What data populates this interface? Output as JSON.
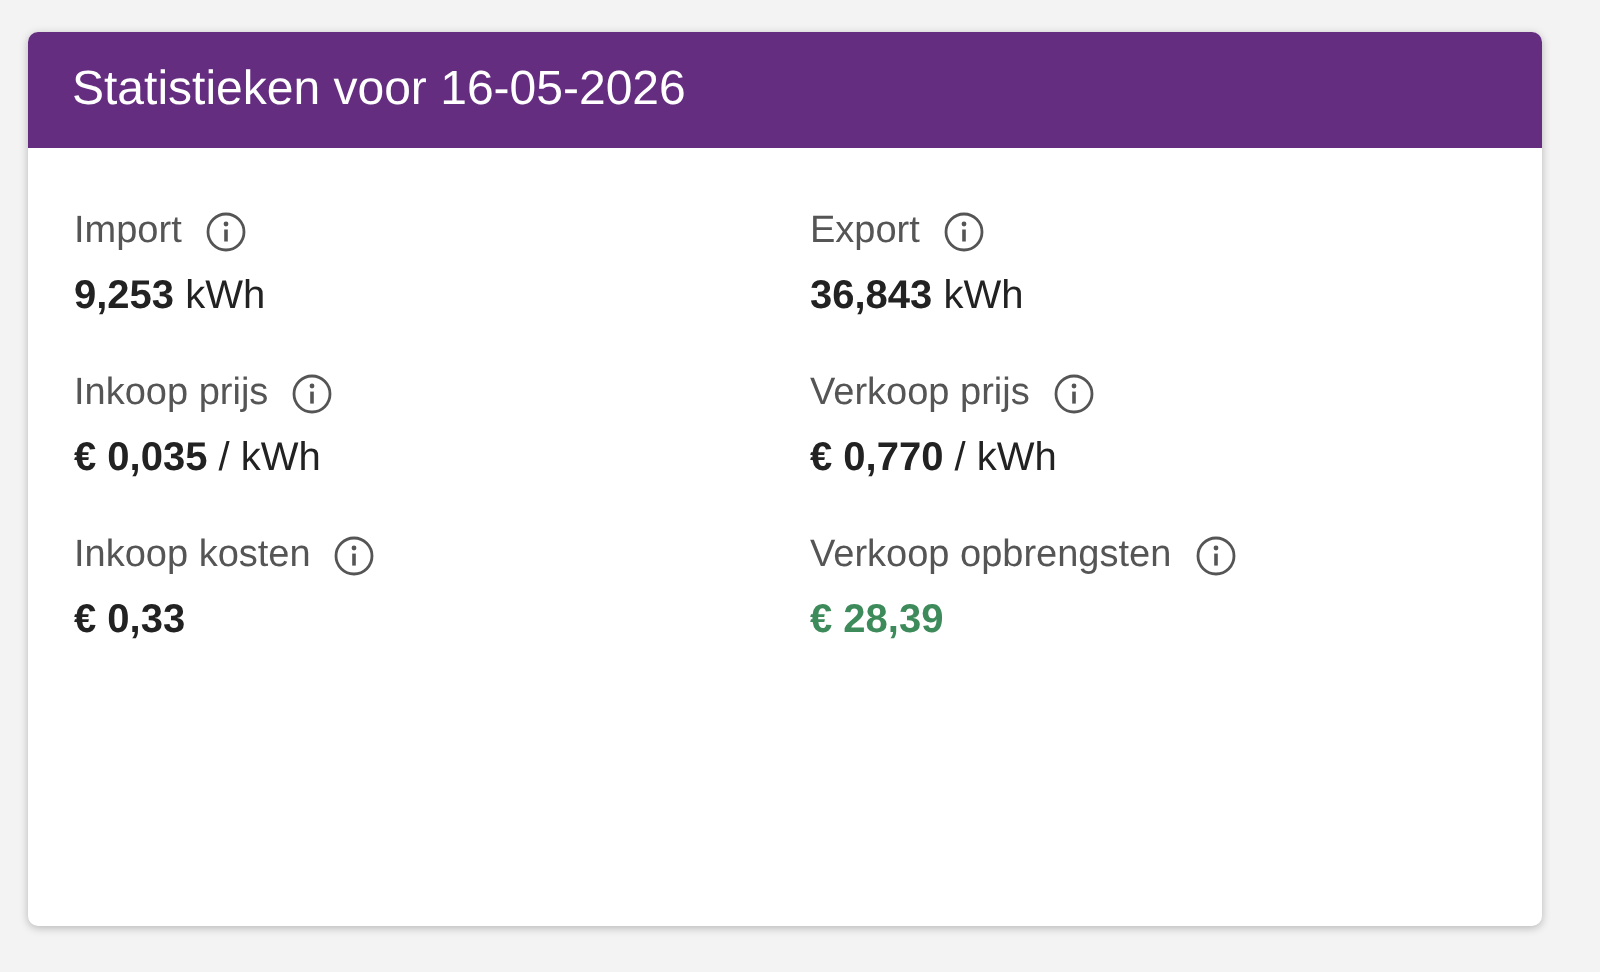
{
  "card": {
    "title": "Statistieken voor 16-05-2026"
  },
  "stats": [
    {
      "label": "Import",
      "value": "**9,253** kWh",
      "color": "#222222"
    },
    {
      "label": "Export",
      "value": "**36,843** kWh",
      "color": "#222222"
    },
    {
      "label": "Inkoop prijs",
      "value": "**€ 0,035** / kWh",
      "color": "#222222"
    },
    {
      "label": "Verkoop prijs",
      "value": "**€ 0,770** / kWh",
      "color": "#222222"
    },
    {
      "label": "Inkoop kosten",
      "value": "**€ 0,33**",
      "color": "#222222"
    },
    {
      "label": "Verkoop opbrengsten",
      "value": "**€ 28,39**",
      "color": "#3d8a5a"
    }
  ]
}
